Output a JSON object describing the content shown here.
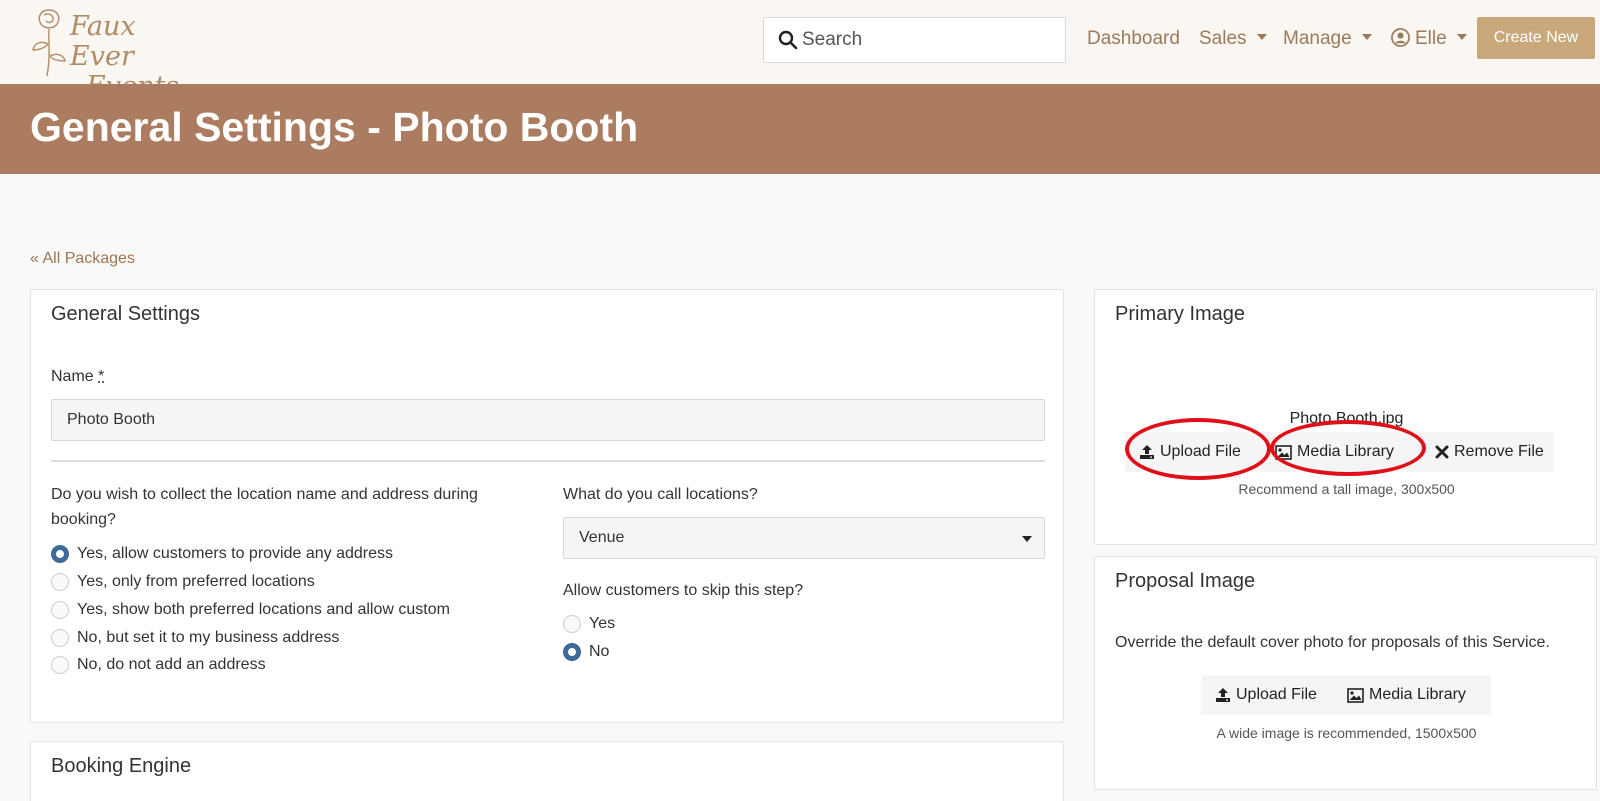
{
  "brand": {
    "logo_line1": "Faux Ever",
    "logo_line2": "Events"
  },
  "search": {
    "placeholder": "Search",
    "value": ""
  },
  "nav": {
    "dashboard": "Dashboard",
    "sales": "Sales",
    "manage": "Manage",
    "user": "Elle",
    "create_new": "Create New"
  },
  "page": {
    "title": "General Settings - Photo Booth",
    "back_link": "« All Packages"
  },
  "general": {
    "title": "General Settings",
    "name_label": "Name",
    "required_mark": "*",
    "name_value": "Photo Booth",
    "collect_question": "Do you wish to collect the location name and address during booking?",
    "collect_options": [
      "Yes, allow customers to provide any address",
      "Yes, only from preferred locations",
      "Yes, show both preferred locations and allow custom",
      "No, but set it to my business address",
      "No, do not add an address"
    ],
    "collect_selected": 0,
    "locations_label": "What do you call locations?",
    "locations_value": "Venue",
    "skip_label": "Allow customers to skip this step?",
    "skip_options": [
      "Yes",
      "No"
    ],
    "skip_selected": 1
  },
  "booking": {
    "title": "Booking Engine"
  },
  "primary_image": {
    "title": "Primary Image",
    "file_name": "Photo Booth.jpg",
    "upload": "Upload File",
    "media": "Media Library",
    "remove": "Remove File",
    "hint": "Recommend a tall image, 300x500"
  },
  "proposal_image": {
    "title": "Proposal Image",
    "description": "Override the default cover photo for proposals of this Service.",
    "upload": "Upload File",
    "media": "Media Library",
    "hint": "A wide image is recommended, 1500x500"
  },
  "colors": {
    "header_bg": "#ab7c60",
    "accent": "#c9a97b",
    "link": "#9a7a5a",
    "radio": "#3d6a96",
    "annotation": "#e0101a"
  }
}
